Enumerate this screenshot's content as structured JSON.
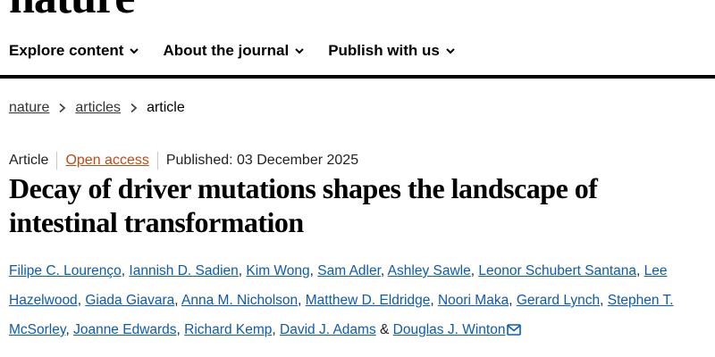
{
  "brand": {
    "logo_text": "nature"
  },
  "nav": {
    "items": [
      {
        "label": "Explore content",
        "icon": "chevron-down-icon"
      },
      {
        "label": "About the journal",
        "icon": "chevron-down-icon"
      },
      {
        "label": "Publish with us",
        "icon": "chevron-down-icon"
      }
    ]
  },
  "breadcrumb": {
    "items": [
      "nature",
      "articles",
      "article"
    ]
  },
  "article": {
    "type": "Article",
    "access": "Open access",
    "published": "Published: 03 December 2025",
    "title": "Decay of driver mutations shapes the landscape of intestinal transformation",
    "authors": [
      "Filipe C. Lourenço",
      "Iannish D. Sadien",
      "Kim Wong",
      "Sam Adler",
      "Ashley Sawle",
      "Leonor Schubert Santana",
      "Lee Hazelwood",
      "Giada Giavara",
      "Anna M. Nicholson",
      "Matthew D. Eldridge",
      "Noori Maka",
      "Gerard Lynch",
      "Stephen T. McSorley",
      "Joanne Edwards",
      "Richard Kemp",
      "David J. Adams",
      "Douglas J. Winton"
    ],
    "final_connector": "&",
    "contact_icon": "mail-icon"
  },
  "colors": {
    "link_blue": "#0b5bb5",
    "open_access_orange": "#c34a10",
    "rule_black": "#000000"
  }
}
